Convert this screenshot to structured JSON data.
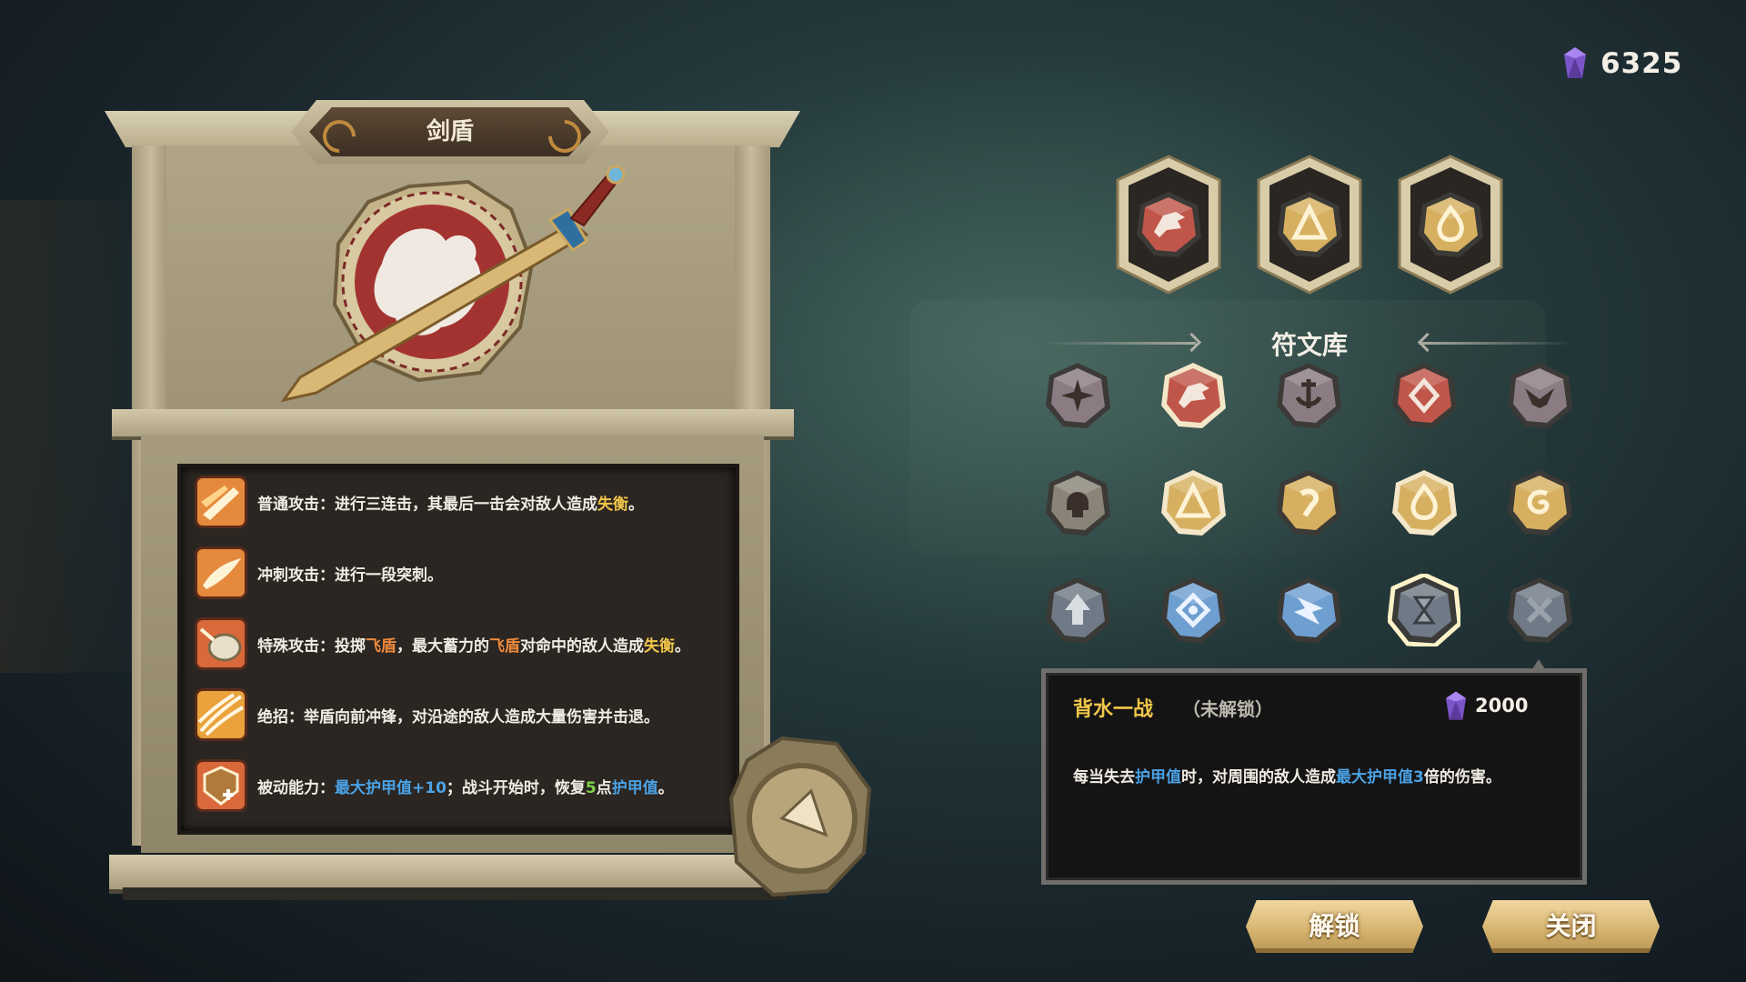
{
  "currency": {
    "amount": "6325",
    "icon": "purple-crystal-icon"
  },
  "weapon_panel": {
    "title": "剑盾",
    "weapon_art": "sword-and-shield-emblem",
    "skills": [
      {
        "icon": "normal-attack-icon",
        "parts": [
          "普通攻击：进行三连击，其最后一击会对敌人造成",
          "失衡",
          "。"
        ]
      },
      {
        "icon": "dash-attack-icon",
        "parts": [
          "冲刺攻击：进行一段突刺。"
        ]
      },
      {
        "icon": "special-attack-icon",
        "parts": [
          "特殊攻击：投掷",
          "飞盾",
          "，最大蓄力的",
          "飞盾",
          "对命中的敌人造成",
          "失衡",
          "。"
        ]
      },
      {
        "icon": "ultimate-icon",
        "parts": [
          "绝招：举盾向前冲锋，对沿途的敌人造成大量伤害并击退。"
        ]
      },
      {
        "icon": "passive-icon",
        "parts": [
          "被动能力：",
          "最大护甲值+10",
          "；战斗开始时，恢复",
          "5",
          "点",
          "护甲值",
          "。"
        ]
      }
    ]
  },
  "equipped_slots": [
    {
      "rune": "wolf-rune-icon",
      "color": "#c0564a"
    },
    {
      "rune": "peak-rune-icon",
      "color": "#d6b060"
    },
    {
      "rune": "flame-rune-icon",
      "color": "#d6b060"
    }
  ],
  "rune_library": {
    "title": "符文库",
    "runes": [
      {
        "icon": "star-rune-icon",
        "color": "#8a7c82",
        "selected": false
      },
      {
        "icon": "wolf-rune-icon",
        "color": "#c0564a",
        "selected": true
      },
      {
        "icon": "anchor-rune-icon",
        "color": "#8a7c82",
        "selected": false
      },
      {
        "icon": "diamond-rune-icon",
        "color": "#c0564a",
        "selected": false
      },
      {
        "icon": "wing-rune-icon",
        "color": "#8a7c82",
        "selected": false
      },
      {
        "icon": "skull-rune-icon",
        "color": "#8a8478",
        "selected": false
      },
      {
        "icon": "peak-rune-icon",
        "color": "#d6b060",
        "selected": true
      },
      {
        "icon": "hook-rune-icon",
        "color": "#d6b060",
        "selected": false
      },
      {
        "icon": "flame-rune-icon",
        "color": "#d6b060",
        "selected": true
      },
      {
        "icon": "spiral-rune-icon",
        "color": "#d6b060",
        "selected": false
      },
      {
        "icon": "arrow-up-rune-icon",
        "color": "#6f7a86",
        "selected": false
      },
      {
        "icon": "target-rune-icon",
        "color": "#6f9fd0",
        "selected": false
      },
      {
        "icon": "bolt-rune-icon",
        "color": "#6f9fd0",
        "selected": false
      },
      {
        "icon": "hourglass-rune-icon",
        "color": "#6f7a86",
        "selected": false,
        "focused": true
      },
      {
        "icon": "cross-rune-icon",
        "color": "#6f7a86",
        "selected": false
      }
    ]
  },
  "rune_info": {
    "name": "背水一战",
    "status": "（未解锁）",
    "cost": "2000",
    "desc_parts": [
      "每当失去",
      "护甲值",
      "时，对周围的敌人造成",
      "最大护甲值",
      "3",
      "倍的伤害。"
    ]
  },
  "buttons": {
    "unlock": "解锁",
    "close": "关闭"
  },
  "colors": {
    "yellow": "#f1c64a",
    "orange": "#ef8a3b",
    "blue": "#4aa3e6",
    "green": "#7fd24a"
  }
}
